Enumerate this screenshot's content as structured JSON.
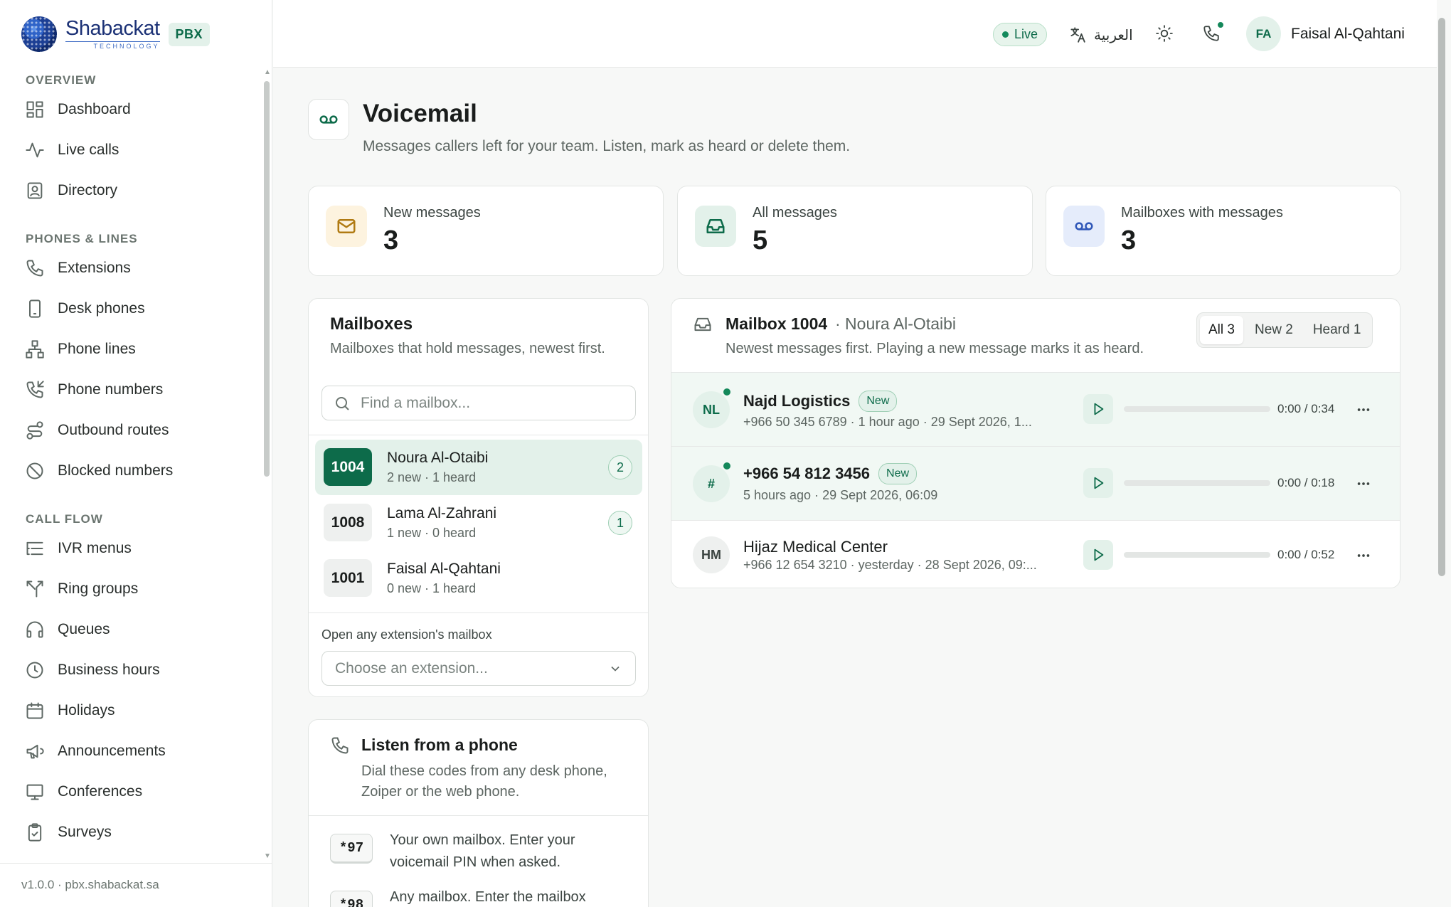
{
  "brand": {
    "name": "Shabackat",
    "tagline": "TECHNOLOGY",
    "product_badge": "PBX"
  },
  "sidebar": {
    "sections": [
      {
        "title": "OVERVIEW",
        "items": [
          {
            "label": "Dashboard",
            "icon": "dashboard-icon"
          },
          {
            "label": "Live calls",
            "icon": "activity-icon"
          },
          {
            "label": "Directory",
            "icon": "contact-icon"
          }
        ]
      },
      {
        "title": "PHONES & LINES",
        "items": [
          {
            "label": "Extensions",
            "icon": "phone-icon"
          },
          {
            "label": "Desk phones",
            "icon": "device-icon"
          },
          {
            "label": "Phone lines",
            "icon": "network-icon"
          },
          {
            "label": "Phone numbers",
            "icon": "phone-incoming-icon"
          },
          {
            "label": "Outbound routes",
            "icon": "route-icon"
          },
          {
            "label": "Blocked numbers",
            "icon": "ban-icon"
          }
        ]
      },
      {
        "title": "CALL FLOW",
        "items": [
          {
            "label": "IVR menus",
            "icon": "list-tree-icon"
          },
          {
            "label": "Ring groups",
            "icon": "split-icon"
          },
          {
            "label": "Queues",
            "icon": "headset-icon"
          },
          {
            "label": "Business hours",
            "icon": "clock-icon"
          },
          {
            "label": "Holidays",
            "icon": "calendar-icon"
          },
          {
            "label": "Announcements",
            "icon": "megaphone-icon"
          },
          {
            "label": "Conferences",
            "icon": "presentation-icon"
          },
          {
            "label": "Surveys",
            "icon": "clipboard-icon"
          }
        ]
      }
    ],
    "footer": "v1.0.0 · pbx.shabackat.sa"
  },
  "topbar": {
    "status": "Live",
    "language": "العربية",
    "user_initials": "FA",
    "user_name": "Faisal Al-Qahtani"
  },
  "page": {
    "title": "Voicemail",
    "subtitle": "Messages callers left for your team. Listen, mark as heard or delete them."
  },
  "stats": [
    {
      "label": "New messages",
      "value": "3",
      "icon": "mail-icon",
      "color": "#fdf3df",
      "stroke": "#b07a12"
    },
    {
      "label": "All messages",
      "value": "5",
      "icon": "inbox-icon",
      "color": "#e3f1ea",
      "stroke": "#0d6b4a"
    },
    {
      "label": "Mailboxes with messages",
      "value": "3",
      "icon": "voicemail-icon",
      "color": "#e5ecfb",
      "stroke": "#2f57b8"
    }
  ],
  "mailboxes": {
    "title": "Mailboxes",
    "subtitle": "Mailboxes that hold messages, newest first.",
    "search_placeholder": "Find a mailbox...",
    "items": [
      {
        "number": "1004",
        "name": "Noura Al-Otaibi",
        "meta": "2 new · 1 heard",
        "count": "2",
        "active": true
      },
      {
        "number": "1008",
        "name": "Lama Al-Zahrani",
        "meta": "1 new · 0 heard",
        "count": "1",
        "active": false
      },
      {
        "number": "1001",
        "name": "Faisal Al-Qahtani",
        "meta": "0 new · 1 heard",
        "count": "",
        "active": false
      }
    ],
    "open_label": "Open any extension's mailbox",
    "select_placeholder": "Choose an extension..."
  },
  "listen": {
    "title": "Listen from a phone",
    "subtitle": "Dial these codes from any desk phone, Zoiper or the web phone.",
    "codes": [
      {
        "code": "*97",
        "text": "Your own mailbox. Enter your voicemail PIN when asked."
      },
      {
        "code": "*98",
        "text": "Any mailbox. Enter the mailbox"
      }
    ]
  },
  "messages": {
    "title": "Mailbox 1004",
    "owner": "· Noura Al-Otaibi",
    "subtitle": "Newest messages first. Playing a new message marks it as heard.",
    "filters": [
      {
        "label": "All 3",
        "active": true
      },
      {
        "label": "New 2",
        "active": false
      },
      {
        "label": "Heard 1",
        "active": false
      }
    ],
    "items": [
      {
        "initials": "NL",
        "caller": "Najd Logistics",
        "badge": "New",
        "meta": "+966 50 345 6789 · 1 hour ago · 29 Sept 2026, 1...",
        "time": "0:00 / 0:34",
        "unread": true,
        "progress": 0
      },
      {
        "initials": "#",
        "caller": "+966 54 812 3456",
        "badge": "New",
        "meta": "5 hours ago · 29 Sept 2026, 06:09",
        "time": "0:00 / 0:18",
        "unread": true,
        "progress": 0
      },
      {
        "initials": "HM",
        "caller": "Hijaz Medical Center",
        "badge": "",
        "meta": "+966 12 654 3210 · yesterday · 28 Sept 2026, 09:...",
        "time": "0:00 / 0:52",
        "unread": false,
        "progress": 0
      }
    ]
  }
}
